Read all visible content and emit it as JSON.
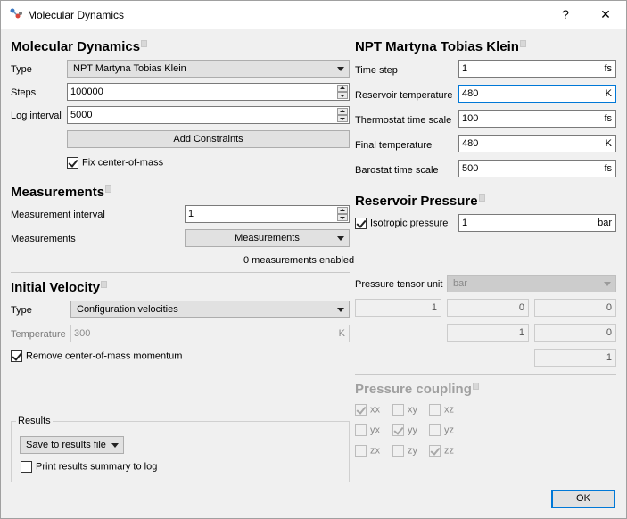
{
  "window": {
    "title": "Molecular Dynamics",
    "help_label": "?",
    "close_label": "✕"
  },
  "md": {
    "title": "Molecular Dynamics",
    "type_label": "Type",
    "type_value": "NPT Martyna Tobias Klein",
    "steps_label": "Steps",
    "steps_value": "100000",
    "log_interval_label": "Log interval",
    "log_interval_value": "5000",
    "add_constraints_label": "Add Constraints",
    "fix_com_label": "Fix center-of-mass",
    "fix_com_checked": true
  },
  "measurements": {
    "title": "Measurements",
    "interval_label": "Measurement interval",
    "interval_value": "1",
    "measurements_label": "Measurements",
    "measurements_button": "Measurements",
    "enabled_text": "0 measurements enabled"
  },
  "velocity": {
    "title": "Initial Velocity",
    "type_label": "Type",
    "type_value": "Configuration velocities",
    "temperature_label": "Temperature",
    "temperature_value": "300",
    "temperature_unit": "K",
    "remove_com_label": "Remove center-of-mass momentum",
    "remove_com_checked": true
  },
  "results": {
    "title": "Results",
    "save_value": "Save to results file",
    "print_summary_label": "Print results summary to log",
    "print_summary_checked": false
  },
  "npt": {
    "title": "NPT Martyna Tobias Klein",
    "time_step_label": "Time step",
    "time_step_value": "1",
    "time_step_unit": "fs",
    "reservoir_temp_label": "Reservoir temperature",
    "reservoir_temp_value": "480",
    "reservoir_temp_unit": "K",
    "thermostat_label": "Thermostat time scale",
    "thermostat_value": "100",
    "thermostat_unit": "fs",
    "final_temp_label": "Final temperature",
    "final_temp_value": "480",
    "final_temp_unit": "K",
    "barostat_label": "Barostat time scale",
    "barostat_value": "500",
    "barostat_unit": "fs"
  },
  "pressure": {
    "title": "Reservoir Pressure",
    "isotropic_label": "Isotropic pressure",
    "isotropic_checked": true,
    "isotropic_value": "1",
    "isotropic_unit": "bar",
    "tensor_unit_label": "Pressure tensor unit",
    "tensor_unit_value": "bar",
    "tensor": {
      "r1c1": "1",
      "r1c2": "0",
      "r1c3": "0",
      "r2c2": "1",
      "r2c3": "0",
      "r3c3": "1"
    }
  },
  "coupling": {
    "title": "Pressure coupling",
    "cells": [
      {
        "label": "xx",
        "checked": true
      },
      {
        "label": "xy",
        "checked": false
      },
      {
        "label": "xz",
        "checked": false
      },
      {
        "label": "yx",
        "checked": false
      },
      {
        "label": "yy",
        "checked": true
      },
      {
        "label": "yz",
        "checked": false
      },
      {
        "label": "zx",
        "checked": false
      },
      {
        "label": "zy",
        "checked": false
      },
      {
        "label": "zz",
        "checked": true
      }
    ]
  },
  "footer": {
    "ok_label": "OK"
  },
  "colors": {
    "accent": "#0078d7",
    "background": "#f0f0f0"
  },
  "icons": {
    "app": "molecule-icon"
  }
}
